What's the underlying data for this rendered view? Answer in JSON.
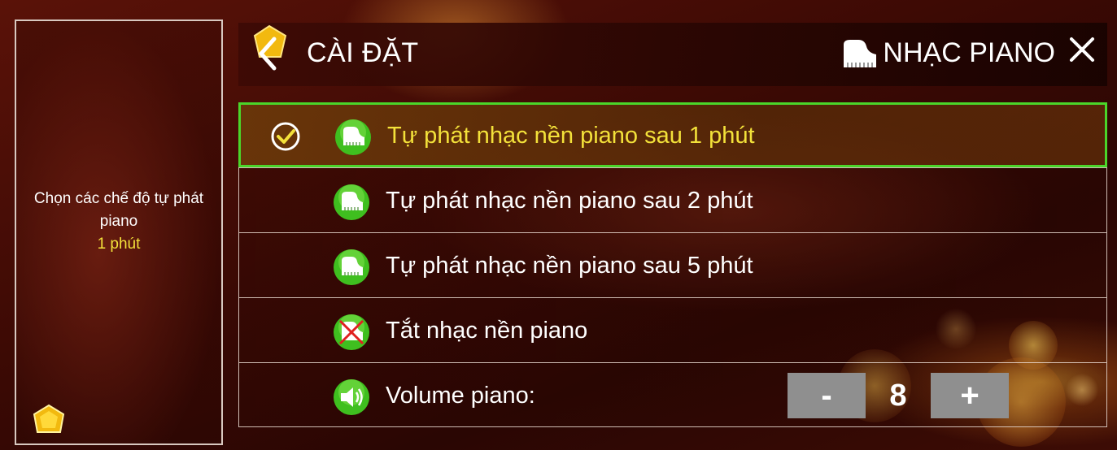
{
  "left_panel": {
    "description": "Chọn các chế độ tự phát piano",
    "selected_value": "1 phút"
  },
  "header": {
    "title": "CÀI ĐẶT",
    "section": "NHẠC PIANO"
  },
  "options": [
    {
      "label": "Tự phát nhạc nền piano sau 1 phút",
      "selected": true,
      "icon": "piano-icon"
    },
    {
      "label": "Tự phát nhạc nền piano sau 2 phút",
      "selected": false,
      "icon": "piano-icon"
    },
    {
      "label": "Tự phát nhạc nền piano sau 5 phút",
      "selected": false,
      "icon": "piano-icon"
    },
    {
      "label": "Tắt nhạc nền piano",
      "selected": false,
      "icon": "piano-off-icon"
    }
  ],
  "volume": {
    "label": "Volume piano:",
    "value": "8",
    "minus_label": "-",
    "plus_label": "+",
    "icon": "speaker-icon"
  },
  "colors": {
    "accent_yellow": "#f3e13a",
    "selection_border": "#4ad62a",
    "icon_green": "#3fbf1f",
    "stepper_gray": "#8f8f8f"
  }
}
